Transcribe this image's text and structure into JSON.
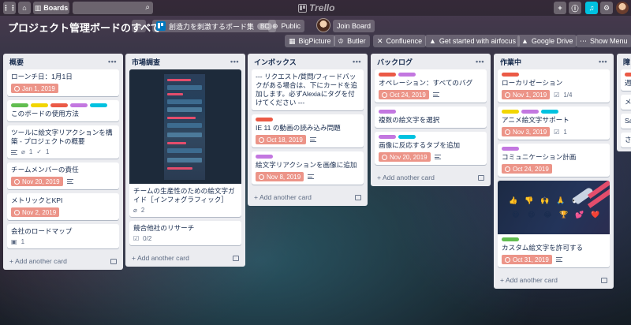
{
  "topbar": {
    "boards_label": "Boards",
    "logo_text": "Trello"
  },
  "header": {
    "board_title": "プロジェクト管理ボードのすべて",
    "team_name": "創造力を刺激するボード集",
    "team_badge": "BC",
    "visibility": "Public",
    "join_label": "Join Board"
  },
  "powerups": [
    "BigPicture",
    "Butler",
    "Confluence",
    "Get started with airfocus",
    "Google Drive",
    "Show Menu"
  ],
  "ui": {
    "add_card": "Add another card"
  },
  "lists": [
    {
      "title": "概要",
      "cards": [
        {
          "title": "ローンチ日：1月1日",
          "due": "Jan 1, 2019"
        },
        {
          "title": "このボードの使用方法",
          "labels": [
            "#61bd4f",
            "#f2d600",
            "#eb5a46",
            "#c377e0",
            "#00c2e0"
          ]
        },
        {
          "title": "ツールに絵文字リアクションを構築 - プロジェクトの概要",
          "attachments": "1",
          "checklist": "1"
        },
        {
          "title": "チームメンバーの責任",
          "due": "Nov 20, 2019"
        },
        {
          "title": "メトリックとKPI",
          "due": "Nov 2, 2019"
        },
        {
          "title": "会社のロードマップ",
          "attachments": "1"
        }
      ]
    },
    {
      "title": "市場調査",
      "cards": [
        {
          "title": "チームの生産性のための絵文字ガイド［インフォグラフィック］",
          "attachments": "2"
        },
        {
          "title": "競合他社のリサーチ",
          "checklist": "0/2"
        }
      ]
    },
    {
      "title": "インボックス",
      "cards": [
        {
          "title": "--- リクエスト/質問/フィードバックがある場合は、下にカードを追加します。必ずAlexiaにタグを付けてください ---"
        },
        {
          "title": "IE 11 の動画の読み込み問題",
          "due": "Oct 18, 2019"
        },
        {
          "title": "絵文字リアクションを画像に追加",
          "due": "Nov 8, 2019"
        }
      ]
    },
    {
      "title": "バックログ",
      "cards": [
        {
          "title": "オペレーション：すべてのバグ",
          "due": "Oct 24, 2019"
        },
        {
          "title": "複数の絵文字を選択"
        },
        {
          "title": "画像に反応するタブを追加",
          "due": "Nov 20, 2019"
        }
      ]
    },
    {
      "title": "作業中",
      "cards": [
        {
          "title": "ローカリゼーション",
          "due": "Nov 1, 2019",
          "checklist": "1/4"
        },
        {
          "title": "アニメ絵文字サポート",
          "due": "Nov 3, 2019",
          "checklist": "1"
        },
        {
          "title": "コミュニケーション計画",
          "due": "Oct 24, 2019"
        },
        {
          "title": "カスタム絵文字を許可する",
          "due": "Oct 31, 2019"
        }
      ]
    },
    {
      "title": "障",
      "cards": [
        {
          "title": "週"
        },
        {
          "title": "メ"
        },
        {
          "title": "Sa"
        },
        {
          "title": "さ"
        }
      ]
    }
  ],
  "colors": {
    "label_red": "#eb5a46",
    "label_purple": "#c377e0",
    "label_green": "#61bd4f",
    "label_yellow": "#f2d600",
    "label_sky": "#00c2e0",
    "due_overdue": "#ec9488"
  },
  "icons": {
    "grid": "grid-icon",
    "home": "home-icon",
    "board": "board-icon",
    "search": "search-icon",
    "plus": "plus-icon",
    "info": "info-icon",
    "bell": "bell-icon",
    "gear": "gear-icon",
    "star": "star-icon",
    "globe": "globe-icon"
  }
}
